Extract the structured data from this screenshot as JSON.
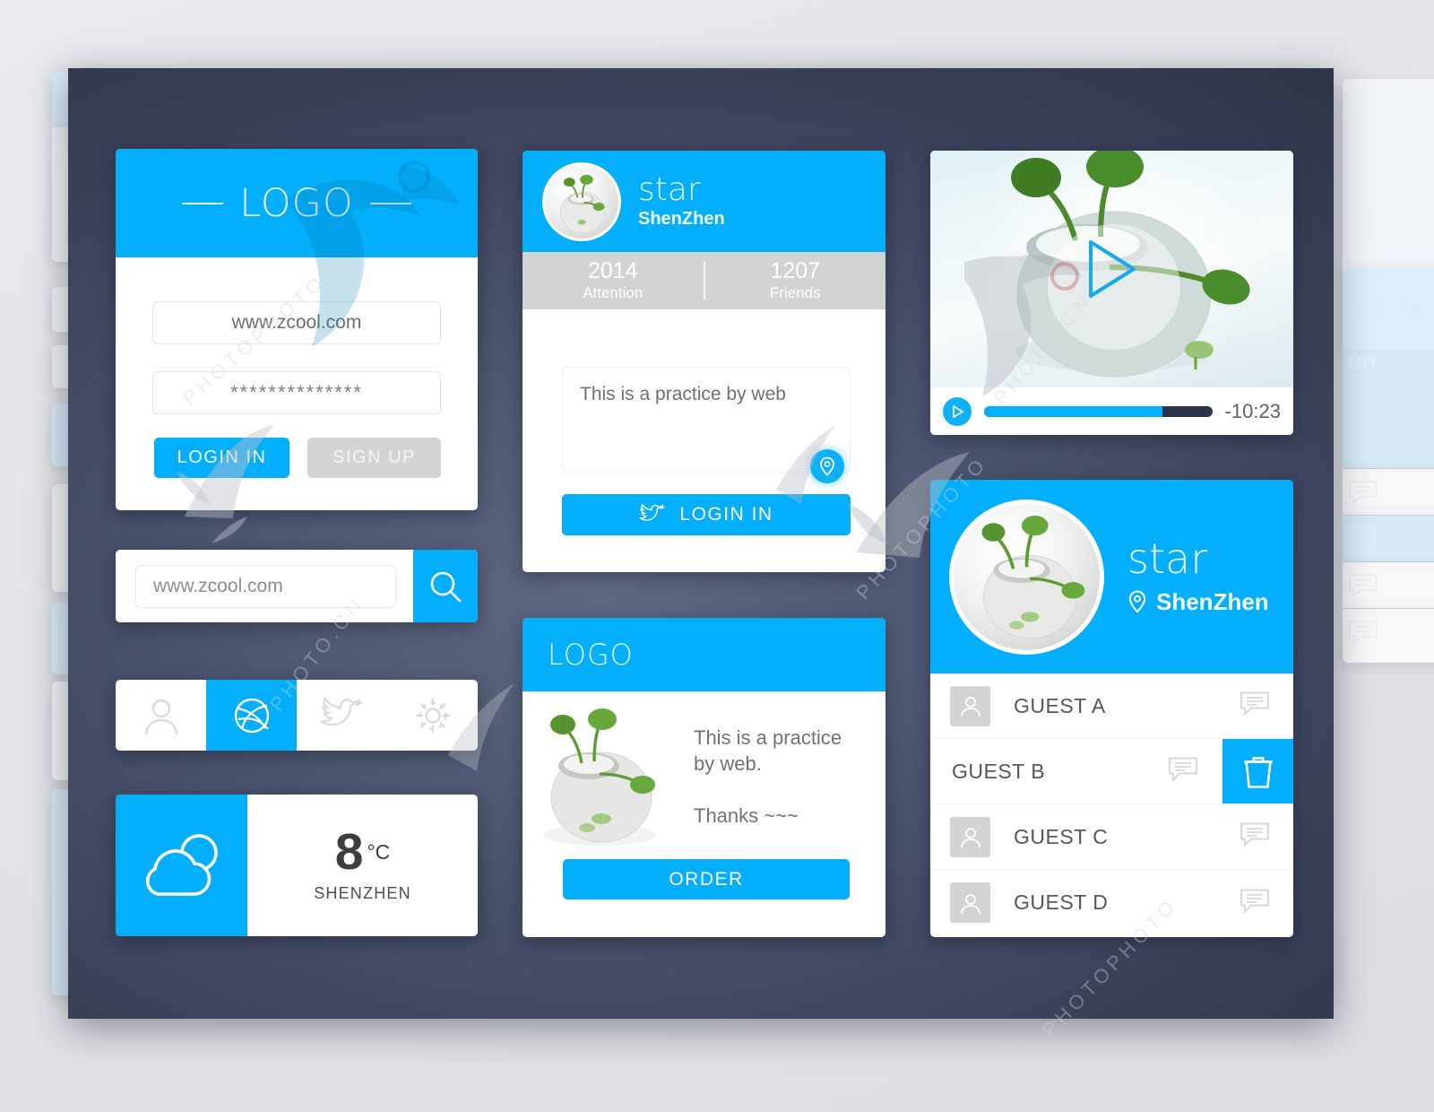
{
  "theme": {
    "accent": "#03aefa",
    "canvas_dark": "#2e3447",
    "page_bg": "#e4e6ea",
    "muted_gray": "#d2d3d5"
  },
  "login_card": {
    "logo": "LOGO",
    "username_value": "www.zcool.com",
    "password_value": "**************",
    "login_label": "LOGIN IN",
    "signup_label": "SIGN UP"
  },
  "search_bar": {
    "value": "www.zcool.com",
    "icon": "search-icon"
  },
  "icon_tabs": {
    "items": [
      {
        "name": "user-icon",
        "active": false
      },
      {
        "name": "dribbble-icon",
        "active": true
      },
      {
        "name": "twitter-icon",
        "active": false
      },
      {
        "name": "gear-icon",
        "active": false
      }
    ]
  },
  "weather_card": {
    "icon": "cloud-icon",
    "temperature": "8",
    "unit": "°C",
    "city": "SHENZHEN"
  },
  "post_card": {
    "avatar": "plant-pot-avatar",
    "name": "star",
    "location": "ShenZhen",
    "stats": [
      {
        "value": "2014",
        "label": "Attention"
      },
      {
        "value": "1207",
        "label": "Friends"
      }
    ],
    "message": "This is a practice by web",
    "pin_icon": "location-pin-icon",
    "login_icon": "twitter-icon",
    "login_label": "LOGIN IN"
  },
  "order_card": {
    "logo": "LOGO",
    "image": "plant-pot-photo",
    "line1": "This is a practice",
    "line2": "by web.",
    "line3": "Thanks ~~~",
    "order_label": "ORDER"
  },
  "video_card": {
    "poster": "plant-pot-photo",
    "play_overlay_icon": "play-triangle-icon",
    "play_button_icon": "play-icon",
    "progress_percent": 78,
    "time_remaining": "-10:23"
  },
  "guest_card": {
    "avatar": "plant-pot-avatar",
    "name": "star",
    "location": "ShenZhen",
    "location_icon": "location-pin-icon",
    "rows": [
      {
        "name": "GUEST A",
        "swiped": false,
        "chat_icon": "chat-bubble-icon"
      },
      {
        "name": "GUEST B",
        "swiped": true,
        "chat_icon": "chat-bubble-icon",
        "delete_icon": "trash-icon"
      },
      {
        "name": "GUEST C",
        "swiped": false,
        "chat_icon": "chat-bubble-icon"
      },
      {
        "name": "GUEST D",
        "swiped": false,
        "chat_icon": "chat-bubble-icon"
      }
    ]
  },
  "ghost_previews": {
    "time_remaining": "-10:23",
    "location_fragment": "en"
  },
  "watermarks": {
    "site_a": "PHOTOPHOTO",
    "site_b": "PHOTO.CN"
  }
}
